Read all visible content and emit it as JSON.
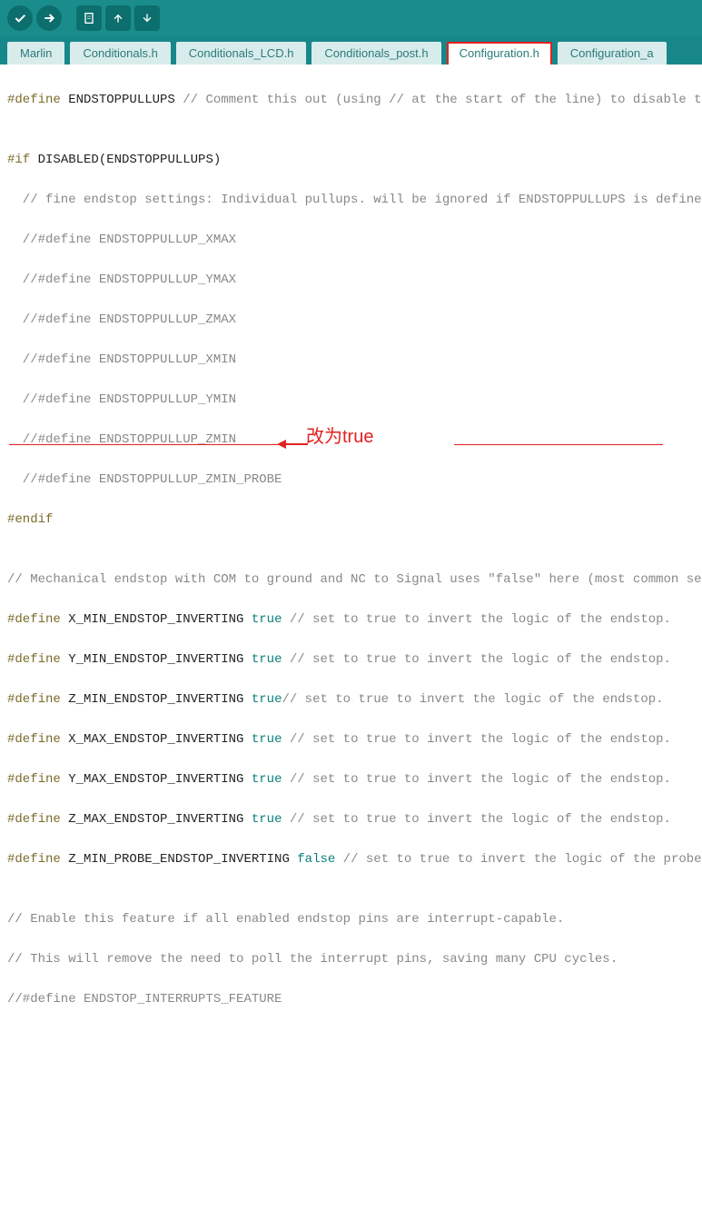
{
  "toolbar": {
    "verify_icon": "check",
    "upload_icon": "arrow-right",
    "new_icon": "file",
    "open_icon": "arrow-up",
    "save_icon": "arrow-down"
  },
  "tabs": [
    {
      "label": "Marlin"
    },
    {
      "label": "Conditionals.h"
    },
    {
      "label": "Conditionals_LCD.h"
    },
    {
      "label": "Conditionals_post.h"
    },
    {
      "label": "Configuration.h",
      "active": true
    },
    {
      "label": "Configuration_a"
    }
  ],
  "annotation": {
    "text": "改为true"
  },
  "code": {
    "l1_def": "#define",
    "l1_id": " ENDSTOPPULLUPS ",
    "l1_c": "// Comment this out (using // at the start of the line) to disable the en",
    "l2": "",
    "l3_if": "#if",
    "l3_rest": " DISABLED(ENDSTOPPULLUPS)",
    "l4": "  // fine endstop settings: Individual pullups. will be ignored if ENDSTOPPULLUPS is defined",
    "l5": "  //#define ENDSTOPPULLUP_XMAX",
    "l6": "  //#define ENDSTOPPULLUP_YMAX",
    "l7": "  //#define ENDSTOPPULLUP_ZMAX",
    "l8": "  //#define ENDSTOPPULLUP_XMIN",
    "l9": "  //#define ENDSTOPPULLUP_YMIN",
    "l10": "  //#define ENDSTOPPULLUP_ZMIN",
    "l11": "  //#define ENDSTOPPULLUP_ZMIN_PROBE",
    "l12": "#endif",
    "l13": "",
    "l14": "// Mechanical endstop with COM to ground and NC to Signal uses \"false\" here (most common setup).",
    "l15_def": "#define",
    "l15_id": " X_MIN_ENDSTOP_INVERTING ",
    "l15_v": "true",
    "l15_c": " // set to true to invert the logic of the endstop.",
    "l16_def": "#define",
    "l16_id": " Y_MIN_ENDSTOP_INVERTING ",
    "l16_v": "true",
    "l16_c": " // set to true to invert the logic of the endstop.",
    "l17_def": "#define",
    "l17_id": " Z_MIN_ENDSTOP_INVERTING ",
    "l17_v": "true",
    "l17_c": "// set to true to invert the logic of the endstop.",
    "l18_def": "#define",
    "l18_id": " X_MAX_ENDSTOP_INVERTING ",
    "l18_v": "true",
    "l18_c": " // set to true to invert the logic of the endstop.",
    "l19_def": "#define",
    "l19_id": " Y_MAX_ENDSTOP_INVERTING ",
    "l19_v": "true",
    "l19_c": " // set to true to invert the logic of the endstop.",
    "l20_def": "#define",
    "l20_id": " Z_MAX_ENDSTOP_INVERTING ",
    "l20_v": "true",
    "l20_c": " // set to true to invert the logic of the endstop.",
    "l21_def": "#define",
    "l21_id": " Z_MIN_PROBE_ENDSTOP_INVERTING ",
    "l21_v": "false",
    "l21_c": " // set to true to invert the logic of the probe.",
    "l22": "",
    "l23": "// Enable this feature if all enabled endstop pins are interrupt-capable.",
    "l24": "// This will remove the need to poll the interrupt pins, saving many CPU cycles.",
    "l25": "//#define ENDSTOP_INTERRUPTS_FEATURE"
  }
}
